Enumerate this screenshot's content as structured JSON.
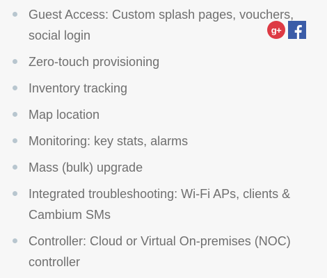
{
  "social": {
    "google_label": "g+",
    "google_color": "#dd3a44",
    "facebook_label": "f",
    "facebook_color": "#3b5ca8"
  },
  "features": [
    "Guest Access: Custom splash pages, vouchers, social login",
    "Zero-touch provisioning",
    "Inventory tracking",
    "Map location",
    "Monitoring: key stats, alarms",
    "Mass (bulk) upgrade",
    "Integrated troubleshooting: Wi-Fi APs, clients & Cambium SMs",
    "Controller: Cloud or Virtual On-premises (NOC) controller"
  ],
  "colors": {
    "text": "#6f6f6f",
    "bullet": "#b8c6cf",
    "background": "#f7f7f7"
  }
}
